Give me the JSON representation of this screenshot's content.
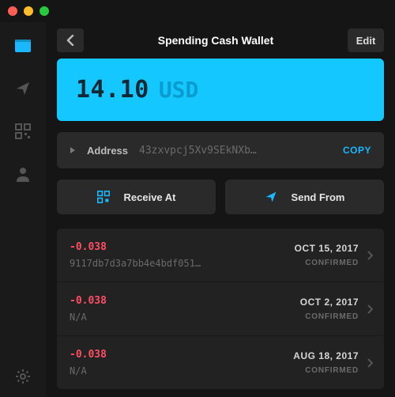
{
  "header": {
    "title": "Spending Cash Wallet",
    "edit_label": "Edit"
  },
  "balance": {
    "amount": "14.10",
    "currency": "USD"
  },
  "address": {
    "label": "Address",
    "value": "43zxvpcj5Xv9SEkNXb…",
    "copy_label": "COPY"
  },
  "actions": {
    "receive_label": "Receive At",
    "send_label": "Send From"
  },
  "transactions": [
    {
      "amount": "-0.038",
      "hash": "9117db7d3a7bb4e4bdf051…",
      "date": "OCT 15, 2017",
      "status": "CONFIRMED"
    },
    {
      "amount": "-0.038",
      "hash": "N/A",
      "date": "OCT 2, 2017",
      "status": "CONFIRMED"
    },
    {
      "amount": "-0.038",
      "hash": "N/A",
      "date": "AUG 18, 2017",
      "status": "CONFIRMED"
    }
  ],
  "colors": {
    "accent": "#19b8ff",
    "balance_bg": "#15c7ff",
    "negative": "#ff4d63"
  }
}
